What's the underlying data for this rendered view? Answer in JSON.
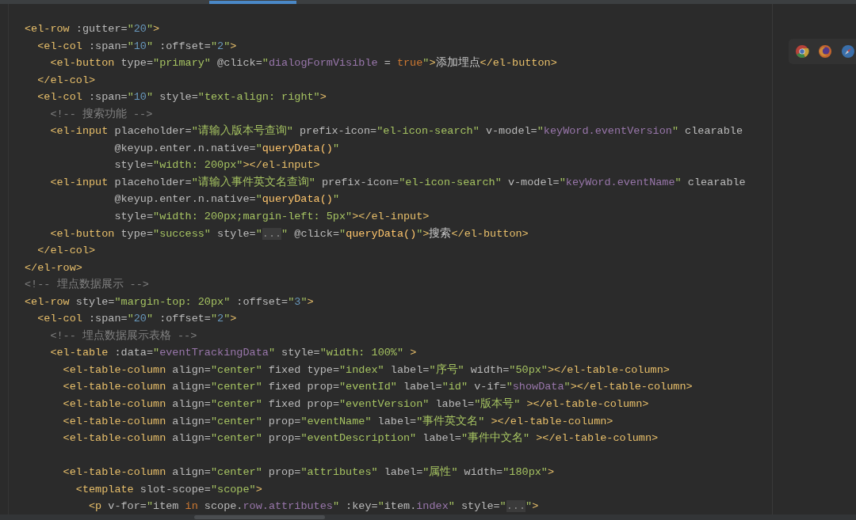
{
  "editor": {
    "lines": [
      {
        "tokens": [
          {
            "kind": "tag",
            "s": "<el-row"
          },
          {
            "kind": "attr",
            "s": " :gutter="
          },
          {
            "kind": "string",
            "s": "\""
          },
          {
            "kind": "number",
            "s": "20"
          },
          {
            "kind": "string",
            "s": "\""
          },
          {
            "kind": "tag",
            "s": ">"
          }
        ]
      },
      {
        "tokens": [
          {
            "kind": "tag",
            "s": "  <el-col"
          },
          {
            "kind": "attr",
            "s": " :span="
          },
          {
            "kind": "string",
            "s": "\""
          },
          {
            "kind": "number",
            "s": "10"
          },
          {
            "kind": "string",
            "s": "\""
          },
          {
            "kind": "attr",
            "s": " :offset="
          },
          {
            "kind": "string",
            "s": "\""
          },
          {
            "kind": "number",
            "s": "2"
          },
          {
            "kind": "string",
            "s": "\""
          },
          {
            "kind": "tag",
            "s": ">"
          }
        ]
      },
      {
        "tokens": [
          {
            "kind": "tag",
            "s": "    <el-button"
          },
          {
            "kind": "attr",
            "s": " type="
          },
          {
            "kind": "string",
            "s": "\"primary\""
          },
          {
            "kind": "attr",
            "s": " @click="
          },
          {
            "kind": "string",
            "s": "\""
          },
          {
            "kind": "variable",
            "s": "dialogFormVisible"
          },
          {
            "kind": "attr",
            "s": " = "
          },
          {
            "kind": "keyword",
            "s": "true"
          },
          {
            "kind": "string",
            "s": "\""
          },
          {
            "kind": "tag",
            "s": ">"
          },
          {
            "kind": "text",
            "s": "添加埋点"
          },
          {
            "kind": "tag",
            "s": "</el-button>"
          }
        ]
      },
      {
        "tokens": [
          {
            "kind": "tag",
            "s": "  </el-col>"
          }
        ]
      },
      {
        "tokens": [
          {
            "kind": "tag",
            "s": "  <el-col"
          },
          {
            "kind": "attr",
            "s": " :span="
          },
          {
            "kind": "string",
            "s": "\""
          },
          {
            "kind": "number",
            "s": "10"
          },
          {
            "kind": "string",
            "s": "\""
          },
          {
            "kind": "attr",
            "s": " style="
          },
          {
            "kind": "string",
            "s": "\"text-align: right\""
          },
          {
            "kind": "tag",
            "s": ">"
          }
        ]
      },
      {
        "tokens": [
          {
            "kind": "comment",
            "s": "    <!-- 搜索功能 -->"
          }
        ]
      },
      {
        "tokens": [
          {
            "kind": "tag",
            "s": "    <el-input"
          },
          {
            "kind": "attr",
            "s": " placeholder="
          },
          {
            "kind": "string",
            "s": "\"请输入版本号查询\""
          },
          {
            "kind": "attr",
            "s": " prefix-icon="
          },
          {
            "kind": "string",
            "s": "\"el-icon-search\""
          },
          {
            "kind": "attr",
            "s": " v-model="
          },
          {
            "kind": "string",
            "s": "\""
          },
          {
            "kind": "variable",
            "s": "keyWord.eventVersion"
          },
          {
            "kind": "string",
            "s": "\""
          },
          {
            "kind": "attr",
            "s": " clearable"
          }
        ]
      },
      {
        "tokens": [
          {
            "kind": "attr",
            "s": "              @keyup.enter.n.native="
          },
          {
            "kind": "string",
            "s": "\""
          },
          {
            "kind": "function",
            "s": "queryData()"
          },
          {
            "kind": "string",
            "s": "\""
          }
        ]
      },
      {
        "tokens": [
          {
            "kind": "attr",
            "s": "              style="
          },
          {
            "kind": "string",
            "s": "\"width: 200px\""
          },
          {
            "kind": "tag",
            "s": "></el-input>"
          }
        ]
      },
      {
        "tokens": [
          {
            "kind": "tag",
            "s": "    <el-input"
          },
          {
            "kind": "attr",
            "s": " placeholder="
          },
          {
            "kind": "string",
            "s": "\"请输入事件英文名查询\""
          },
          {
            "kind": "attr",
            "s": " prefix-icon="
          },
          {
            "kind": "string",
            "s": "\"el-icon-search\""
          },
          {
            "kind": "attr",
            "s": " v-model="
          },
          {
            "kind": "string",
            "s": "\""
          },
          {
            "kind": "variable",
            "s": "keyWord.eventName"
          },
          {
            "kind": "string",
            "s": "\""
          },
          {
            "kind": "attr",
            "s": " clearable"
          }
        ]
      },
      {
        "tokens": [
          {
            "kind": "attr",
            "s": "              @keyup.enter.n.native="
          },
          {
            "kind": "string",
            "s": "\""
          },
          {
            "kind": "function",
            "s": "queryData()"
          },
          {
            "kind": "string",
            "s": "\""
          }
        ]
      },
      {
        "tokens": [
          {
            "kind": "attr",
            "s": "              style="
          },
          {
            "kind": "string",
            "s": "\"width: 200px;margin-left: 5px\""
          },
          {
            "kind": "tag",
            "s": "></el-input>"
          }
        ]
      },
      {
        "tokens": [
          {
            "kind": "tag",
            "s": "    <el-button"
          },
          {
            "kind": "attr",
            "s": " type="
          },
          {
            "kind": "string",
            "s": "\"success\""
          },
          {
            "kind": "attr",
            "s": " style="
          },
          {
            "kind": "string",
            "s": "\""
          },
          {
            "kind": "fold",
            "s": "..."
          },
          {
            "kind": "string",
            "s": "\""
          },
          {
            "kind": "attr",
            "s": " @click="
          },
          {
            "kind": "string",
            "s": "\""
          },
          {
            "kind": "function",
            "s": "queryData()"
          },
          {
            "kind": "string",
            "s": "\""
          },
          {
            "kind": "tag",
            "s": ">"
          },
          {
            "kind": "text",
            "s": "搜索"
          },
          {
            "kind": "tag",
            "s": "</el-button>"
          }
        ]
      },
      {
        "tokens": [
          {
            "kind": "tag",
            "s": "  </el-col>"
          }
        ]
      },
      {
        "tokens": [
          {
            "kind": "tag",
            "s": "</el-row>"
          }
        ]
      },
      {
        "tokens": [
          {
            "kind": "comment",
            "s": "<!-- 埋点数据展示 -->"
          }
        ]
      },
      {
        "tokens": [
          {
            "kind": "tag",
            "s": "<el-row"
          },
          {
            "kind": "attr",
            "s": " style="
          },
          {
            "kind": "string",
            "s": "\"margin-top: 20px\""
          },
          {
            "kind": "attr",
            "s": " :offset="
          },
          {
            "kind": "string",
            "s": "\""
          },
          {
            "kind": "number",
            "s": "3"
          },
          {
            "kind": "string",
            "s": "\""
          },
          {
            "kind": "tag",
            "s": ">"
          }
        ]
      },
      {
        "tokens": [
          {
            "kind": "tag",
            "s": "  <el-col"
          },
          {
            "kind": "attr",
            "s": " :span="
          },
          {
            "kind": "string",
            "s": "\""
          },
          {
            "kind": "number",
            "s": "20"
          },
          {
            "kind": "string",
            "s": "\""
          },
          {
            "kind": "attr",
            "s": " :offset="
          },
          {
            "kind": "string",
            "s": "\""
          },
          {
            "kind": "number",
            "s": "2"
          },
          {
            "kind": "string",
            "s": "\""
          },
          {
            "kind": "tag",
            "s": ">"
          }
        ]
      },
      {
        "tokens": [
          {
            "kind": "comment",
            "s": "    <!-- 埋点数据展示表格 -->"
          }
        ]
      },
      {
        "tokens": [
          {
            "kind": "tag",
            "s": "    <el-table"
          },
          {
            "kind": "attr",
            "s": " :data="
          },
          {
            "kind": "string",
            "s": "\""
          },
          {
            "kind": "variable",
            "s": "eventTrackingData"
          },
          {
            "kind": "string",
            "s": "\""
          },
          {
            "kind": "attr",
            "s": " style="
          },
          {
            "kind": "string",
            "s": "\"width: 100%\""
          },
          {
            "kind": "tag",
            "s": " >"
          }
        ]
      },
      {
        "tokens": [
          {
            "kind": "tag",
            "s": "      <el-table-column"
          },
          {
            "kind": "attr",
            "s": " align="
          },
          {
            "kind": "string",
            "s": "\"center\""
          },
          {
            "kind": "attr",
            "s": " fixed type="
          },
          {
            "kind": "string",
            "s": "\"index\""
          },
          {
            "kind": "attr",
            "s": " label="
          },
          {
            "kind": "string",
            "s": "\"序号\""
          },
          {
            "kind": "attr",
            "s": " width="
          },
          {
            "kind": "string",
            "s": "\"50px\""
          },
          {
            "kind": "tag",
            "s": "></el-table-column>"
          }
        ]
      },
      {
        "tokens": [
          {
            "kind": "tag",
            "s": "      <el-table-column"
          },
          {
            "kind": "attr",
            "s": " align="
          },
          {
            "kind": "string",
            "s": "\"center\""
          },
          {
            "kind": "attr",
            "s": " fixed prop="
          },
          {
            "kind": "string",
            "s": "\"eventId\""
          },
          {
            "kind": "attr",
            "s": " label="
          },
          {
            "kind": "string",
            "s": "\"id\""
          },
          {
            "kind": "attr",
            "s": " v-if="
          },
          {
            "kind": "string",
            "s": "\""
          },
          {
            "kind": "variable",
            "s": "showData"
          },
          {
            "kind": "string",
            "s": "\""
          },
          {
            "kind": "tag",
            "s": "></el-table-column>"
          }
        ]
      },
      {
        "tokens": [
          {
            "kind": "tag",
            "s": "      <el-table-column"
          },
          {
            "kind": "attr",
            "s": " align="
          },
          {
            "kind": "string",
            "s": "\"center\""
          },
          {
            "kind": "attr",
            "s": " fixed prop="
          },
          {
            "kind": "string",
            "s": "\"eventVersion\""
          },
          {
            "kind": "attr",
            "s": " label="
          },
          {
            "kind": "string",
            "s": "\"版本号\""
          },
          {
            "kind": "tag",
            "s": " ></el-table-column>"
          }
        ]
      },
      {
        "tokens": [
          {
            "kind": "tag",
            "s": "      <el-table-column"
          },
          {
            "kind": "attr",
            "s": " align="
          },
          {
            "kind": "string",
            "s": "\"center\""
          },
          {
            "kind": "attr",
            "s": " prop="
          },
          {
            "kind": "string",
            "s": "\"eventName\""
          },
          {
            "kind": "attr",
            "s": " label="
          },
          {
            "kind": "string",
            "s": "\"事件英文名\""
          },
          {
            "kind": "tag",
            "s": " ></el-table-column>"
          }
        ]
      },
      {
        "tokens": [
          {
            "kind": "tag",
            "s": "      <el-table-column"
          },
          {
            "kind": "attr",
            "s": " align="
          },
          {
            "kind": "string",
            "s": "\"center\""
          },
          {
            "kind": "attr",
            "s": " prop="
          },
          {
            "kind": "string",
            "s": "\"eventDescription\""
          },
          {
            "kind": "attr",
            "s": " label="
          },
          {
            "kind": "string",
            "s": "\"事件中文名\""
          },
          {
            "kind": "tag",
            "s": " ></el-table-column>"
          }
        ]
      },
      {
        "blank_before": true,
        "tokens": [
          {
            "kind": "tag",
            "s": "      <el-table-column"
          },
          {
            "kind": "attr",
            "s": " align="
          },
          {
            "kind": "string",
            "s": "\"center\""
          },
          {
            "kind": "attr",
            "s": " prop="
          },
          {
            "kind": "string",
            "s": "\"attributes\""
          },
          {
            "kind": "attr",
            "s": " label="
          },
          {
            "kind": "string",
            "s": "\"属性\""
          },
          {
            "kind": "attr",
            "s": " width="
          },
          {
            "kind": "string",
            "s": "\"180px\""
          },
          {
            "kind": "tag",
            "s": ">"
          }
        ]
      },
      {
        "tokens": [
          {
            "kind": "tag",
            "s": "        <template"
          },
          {
            "kind": "attr",
            "s": " slot-scope="
          },
          {
            "kind": "string",
            "s": "\"scope\""
          },
          {
            "kind": "tag",
            "s": ">"
          }
        ]
      },
      {
        "tokens": [
          {
            "kind": "tag",
            "s": "          <p"
          },
          {
            "kind": "attr",
            "s": " v-for="
          },
          {
            "kind": "string",
            "s": "\""
          },
          {
            "kind": "attr",
            "s": "item "
          },
          {
            "kind": "keyword",
            "s": "in"
          },
          {
            "kind": "attr",
            "s": " scope."
          },
          {
            "kind": "variable",
            "s": "row.attributes"
          },
          {
            "kind": "string",
            "s": "\""
          },
          {
            "kind": "attr",
            "s": " :key="
          },
          {
            "kind": "string",
            "s": "\""
          },
          {
            "kind": "attr",
            "s": "item."
          },
          {
            "kind": "variable",
            "s": "index"
          },
          {
            "kind": "string",
            "s": "\""
          },
          {
            "kind": "attr",
            "s": " style="
          },
          {
            "kind": "string",
            "s": "\""
          },
          {
            "kind": "fold",
            "s": "..."
          },
          {
            "kind": "string",
            "s": "\""
          },
          {
            "kind": "tag",
            "s": ">"
          }
        ]
      }
    ]
  }
}
